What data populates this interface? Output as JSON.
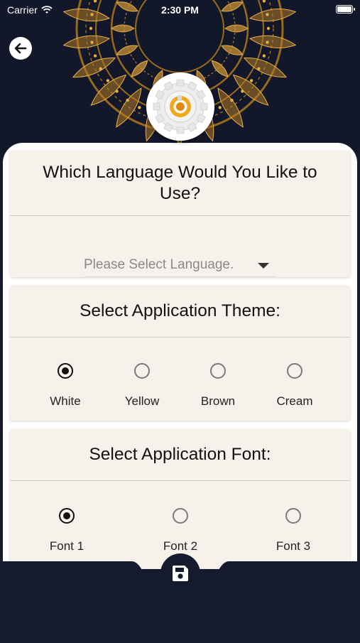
{
  "status_bar": {
    "carrier": "Carrier",
    "time": "2:30 PM",
    "wifi_icon": "wifi-icon",
    "battery_icon": "battery-icon"
  },
  "header": {
    "back_icon": "arrow-left-icon",
    "logo_icon": "app-logo-icon",
    "colors": {
      "background": "#12172a",
      "mandala": "#c8922b"
    }
  },
  "language_section": {
    "title": "Which Language Would You Like to Use?",
    "dropdown_placeholder": "Please Select Language.",
    "dropdown_icon": "caret-down-icon"
  },
  "theme_section": {
    "title": "Select Application Theme:",
    "options": [
      {
        "label": "White",
        "selected": true
      },
      {
        "label": "Yellow",
        "selected": false
      },
      {
        "label": "Brown",
        "selected": false
      },
      {
        "label": "Cream",
        "selected": false
      }
    ]
  },
  "font_section": {
    "title": "Select Application Font:",
    "options": [
      {
        "label": "Font 1",
        "selected": true
      },
      {
        "label": "Font 2",
        "selected": false
      },
      {
        "label": "Font 3",
        "selected": false
      }
    ]
  },
  "footer": {
    "save_icon": "save-floppy-icon",
    "colors": {
      "bar": "#151a2d",
      "card": "#f6f1ea"
    }
  }
}
